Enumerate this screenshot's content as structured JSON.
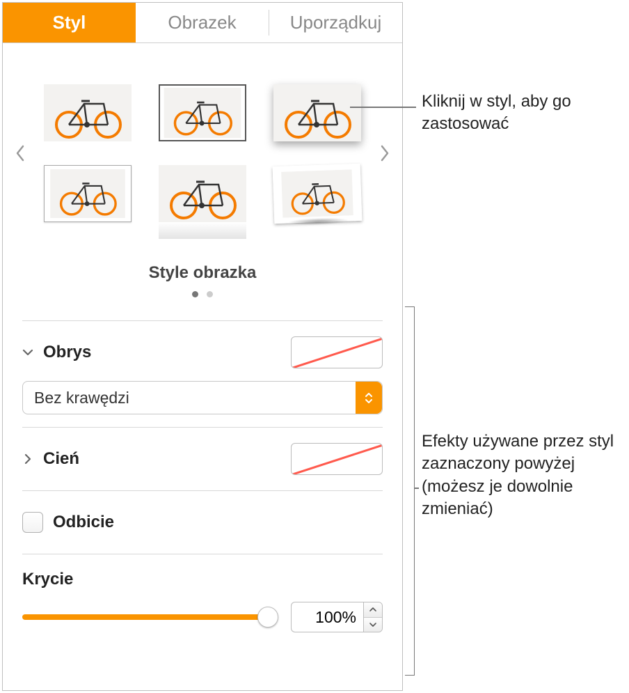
{
  "tabs": {
    "style": "Styl",
    "image": "Obrazek",
    "arrange": "Uporządkuj"
  },
  "styles": {
    "caption": "Style obrazka"
  },
  "sections": {
    "stroke_label": "Obrys",
    "stroke_dropdown": "Bez krawędzi",
    "shadow_label": "Cień",
    "reflection_label": "Odbicie",
    "opacity_label": "Krycie",
    "opacity_value": "100%"
  },
  "callouts": {
    "top": "Kliknij w styl, aby go zastosować",
    "side": "Efekty używane przez styl zaznaczony powyżej (możesz je dowolnie zmieniać)"
  }
}
